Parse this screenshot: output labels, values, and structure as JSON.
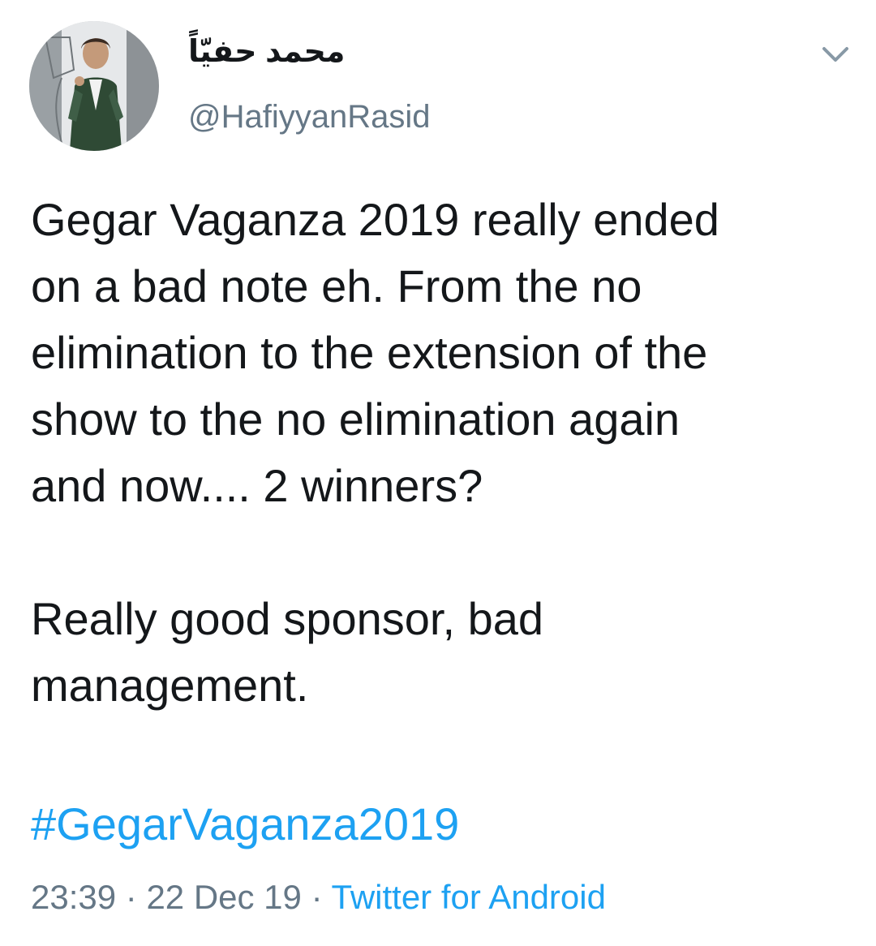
{
  "author": {
    "display_name": "محمد حفيّاً",
    "handle": "@HafiyyanRasid",
    "avatar_icon": "profile-photo"
  },
  "tweet": {
    "text_paragraph_1": "Gegar Vaganza 2019 really ended\non a bad note eh. From the no\nelimination to the extension of the\nshow to the no elimination again\nand now.... 2 winners?\n\nReally good sponsor, bad\nmanagement.",
    "hashtag": "#GegarVaganza2019"
  },
  "meta": {
    "time": "23:39",
    "separator": " · ",
    "date": "22 Dec 19",
    "source": "Twitter for Android"
  },
  "menu": {
    "caret_icon": "chevron-down-icon"
  },
  "colors": {
    "text": "#14171a",
    "secondary": "#657786",
    "link": "#1da1f2"
  }
}
